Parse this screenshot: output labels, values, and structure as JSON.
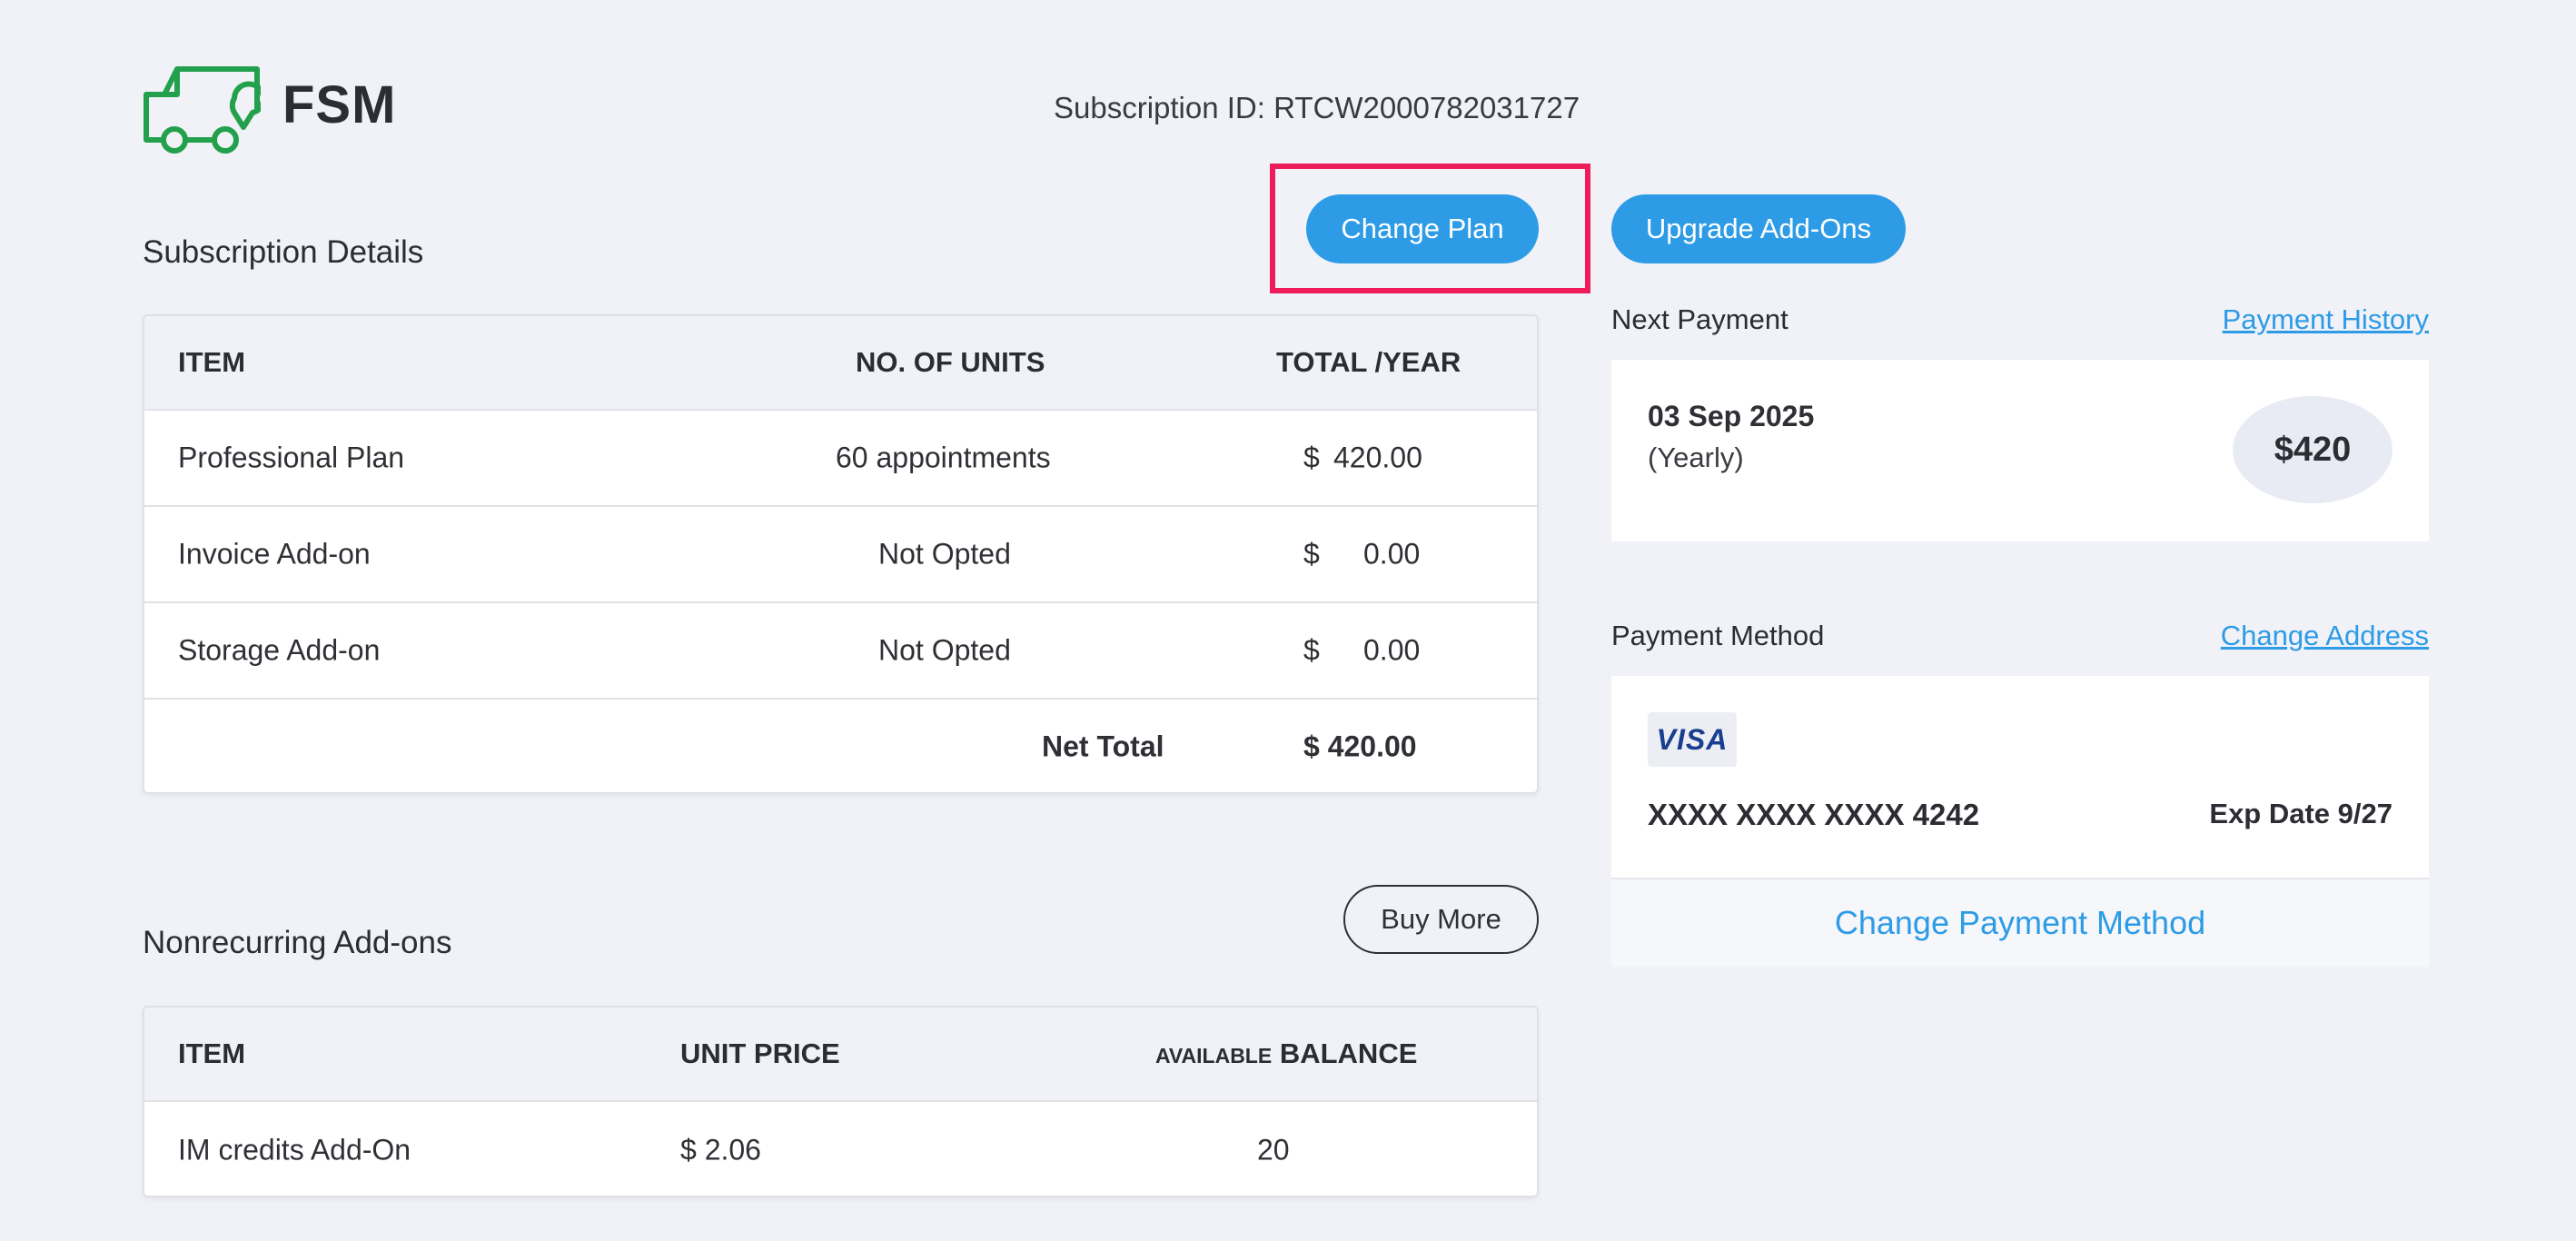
{
  "header": {
    "logo_text": "FSM",
    "subscription_id": "Subscription ID: RTCW2000782031727"
  },
  "actions": {
    "change_plan": "Change Plan",
    "upgrade_addons": "Upgrade Add-Ons",
    "buy_more": "Buy More"
  },
  "subscription": {
    "title": "Subscription Details",
    "columns": [
      "ITEM",
      "NO. OF UNITS",
      "TOTAL /YEAR"
    ],
    "rows": [
      {
        "item": "Professional Plan",
        "units": "60 appointments",
        "currency": "$",
        "total": "420.00"
      },
      {
        "item": "Invoice Add-on",
        "units": "Not Opted",
        "currency": "$",
        "total": "0.00"
      },
      {
        "item": "Storage Add-on",
        "units": "Not Opted",
        "currency": "$",
        "total": "0.00"
      }
    ],
    "net_total_label": "Net Total",
    "net_total_value": "$ 420.00"
  },
  "nonrecurring": {
    "title": "Nonrecurring Add-ons",
    "columns": {
      "item": "ITEM",
      "unit_price": "UNIT PRICE",
      "available_prefix": "AVAILABLE",
      "balance": "BALANCE"
    },
    "rows": [
      {
        "item": "IM credits Add-On",
        "unit_price": "$ 2.06",
        "balance": "20"
      }
    ]
  },
  "next_payment": {
    "label": "Next Payment",
    "history_link": "Payment History",
    "date": "03 Sep 2025",
    "frequency": "(Yearly)",
    "amount": "$420"
  },
  "payment_method": {
    "label": "Payment Method",
    "change_address_link": "Change Address",
    "card_brand": "VISA",
    "card_number": "XXXX XXXX XXXX 4242",
    "exp_date": "Exp Date 9/27",
    "change_method": "Change Payment Method"
  },
  "colors": {
    "accent": "#2d9be6",
    "logo_green": "#22a04b",
    "highlight": "#ee1c5b",
    "background": "#f1f2f7"
  },
  "icons": {
    "logo": "truck-location-icon"
  }
}
